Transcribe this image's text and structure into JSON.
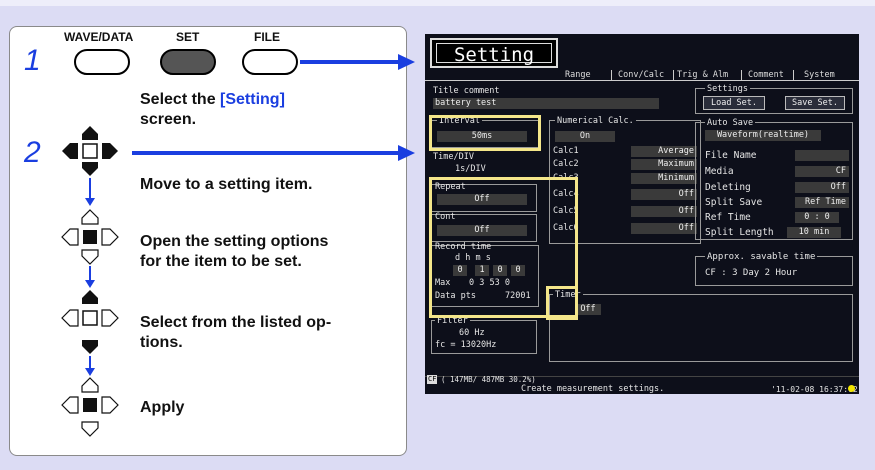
{
  "keys": {
    "wave_data": "WAVE/DATA",
    "set": "SET",
    "file": "FILE"
  },
  "steps": {
    "step1": {
      "num": "1",
      "text_a": "Select the ",
      "text_hl": "[Setting]",
      "text_b": "screen."
    },
    "step2": {
      "num": "2",
      "line1": "Move to a setting item.",
      "line2a": "Open the setting options",
      "line2b": "for the item to be set.",
      "line3a": "Select from the listed op-",
      "line3b": "tions.",
      "line4": "Apply"
    }
  },
  "screen": {
    "tab_setting": "Setting",
    "tabs": [
      "Range",
      "Conv/Calc",
      "Trig & Alm",
      "Comment",
      "System"
    ],
    "title_comment_label": "Title comment",
    "title_comment_value": "battery test",
    "settings_label": "Settings",
    "load_set": "Load Set.",
    "save_set": "Save Set.",
    "interval_label": "Interval",
    "interval_value": "50ms",
    "timediv_label": "Time/DIV",
    "timediv_value": "1s/DIV",
    "numcalc_label": "Numerical Calc.",
    "numcalc_value": "On",
    "calc_rows": [
      {
        "label": "Calc1",
        "value": "Average"
      },
      {
        "label": "Calc2",
        "value": "Maximum"
      },
      {
        "label": "Calc3",
        "value": "Minimum"
      },
      {
        "label": "Calc4",
        "value": "Off"
      },
      {
        "label": "Calc5",
        "value": "Off"
      },
      {
        "label": "Calc6",
        "value": "Off"
      }
    ],
    "repeat_label": "Repeat",
    "repeat_value": "Off",
    "cont_label": "Cont",
    "cont_value": "Off",
    "record_time_label": "Record time",
    "rt_units": "d    h  m  s",
    "rt_values": [
      "0",
      "1",
      "0",
      "0"
    ],
    "max_label": "Max",
    "max_value": "0  3 53  0",
    "datapts_label": "Data pts",
    "datapts_value": "72001",
    "timer_label": "Timer",
    "timer_value": "Off",
    "filter_label": "Filter",
    "filter_value": "60 Hz",
    "fc_value": "fc = 13020Hz",
    "autosave_label": "Auto Save",
    "autosave_value": "Waveform(realtime)",
    "autosave_rows": [
      {
        "label": "File Name",
        "value": ""
      },
      {
        "label": "Media",
        "value": "CF"
      },
      {
        "label": "Deleting",
        "value": "Off"
      },
      {
        "label": "Split Save",
        "value": "Ref Time"
      },
      {
        "label": "Ref Time",
        "value": "0 : 0"
      },
      {
        "label": "Split Length",
        "value": "10 min"
      }
    ],
    "approx_label": "Approx. savable time",
    "approx_value": "CF : 3 Day 2 Hour",
    "status_cf": "CF",
    "status_mem": "( 147MB/ 487MB 30.2%)",
    "status_msg": "Create measurement settings.",
    "status_time": "'11-02-08 16:37:02"
  }
}
